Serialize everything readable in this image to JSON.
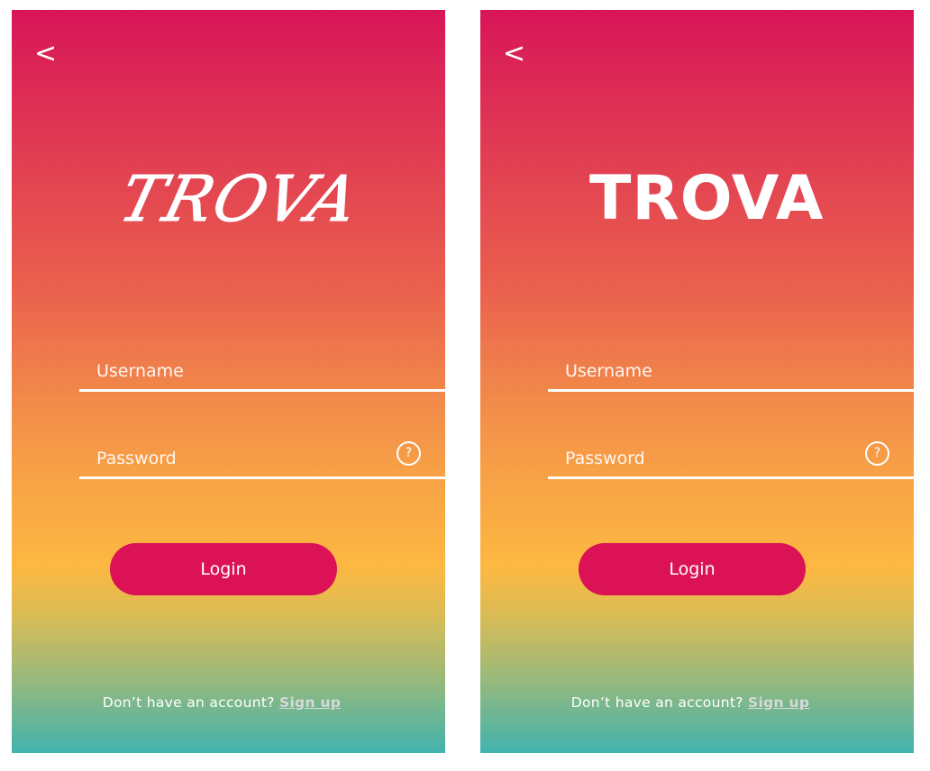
{
  "screens": [
    {
      "back_label": "<",
      "logo_text": "TROVA",
      "username_placeholder": "Username",
      "password_placeholder": "Password",
      "help_icon": "?",
      "login_label": "Login",
      "signup_prompt": "Don’t have an account?",
      "signup_link": "Sign up"
    },
    {
      "back_label": "<",
      "logo_text": "TROVA",
      "username_placeholder": "Username",
      "password_placeholder": "Password",
      "help_icon": "?",
      "login_label": "Login",
      "signup_prompt": "Don’t have an account?",
      "signup_link": "Sign up"
    }
  ],
  "colors": {
    "gradient_top": "#d81558",
    "gradient_mid": "#fdb842",
    "gradient_bottom": "#41b3ae",
    "button": "#db1256",
    "link": "#d6d9d9"
  }
}
